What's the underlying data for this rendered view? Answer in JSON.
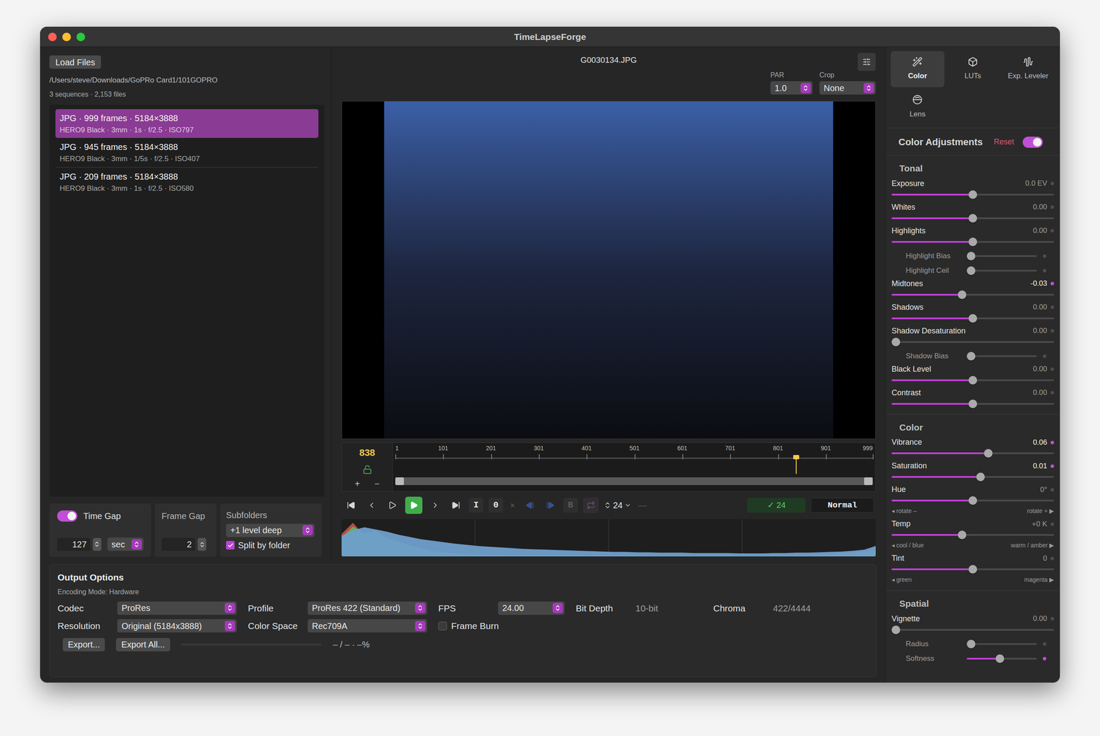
{
  "window": {
    "title": "TimeLapseForge"
  },
  "source": {
    "load_button": "Load Files",
    "path": "/Users/steve/Downloads/GoPRo Card1/101GOPRO",
    "summary": "3 sequences · 2,153 files"
  },
  "sequences": [
    {
      "title": "JPG · 999 frames · 5184×3888",
      "detail": "HERO9 Black · 3mm · 1s · f/2.5 · ISO797",
      "selected": true
    },
    {
      "title": "JPG · 945 frames · 5184×3888",
      "detail": "HERO9 Black · 3mm · 1/5s · f/2.5 · ISO407",
      "selected": false
    },
    {
      "title": "JPG · 209 frames · 5184×3888",
      "detail": "HERO9 Black · 3mm · 1s · f/2.5 · ISO580",
      "selected": false
    }
  ],
  "time_gap": {
    "label": "Time Gap",
    "on": true,
    "value": "127",
    "unit": "sec"
  },
  "frame_gap": {
    "label": "Frame Gap",
    "value": "2"
  },
  "subfolders": {
    "label": "Subfolders",
    "value": "+1 level deep",
    "split_label": "Split by folder",
    "split_checked": true
  },
  "preview": {
    "filename": "G0030134.JPG",
    "par": {
      "label": "PAR",
      "value": "1.0"
    },
    "crop": {
      "label": "Crop",
      "value": "None"
    }
  },
  "timeline": {
    "current_frame": "838",
    "locked": false,
    "add": "+",
    "remove": "−",
    "ticks": [
      "1",
      "101",
      "201",
      "301",
      "401",
      "501",
      "601",
      "701",
      "801",
      "901",
      "999"
    ],
    "playhead": 0.839,
    "range_start": 0,
    "range_end": 1
  },
  "transport": [
    {
      "kind": "first",
      "disabled": false
    },
    {
      "kind": "prev",
      "disabled": false
    },
    {
      "kind": "play",
      "disabled": false
    },
    {
      "kind": "play-green",
      "disabled": false
    },
    {
      "kind": "next",
      "disabled": false
    },
    {
      "kind": "last",
      "disabled": false
    },
    {
      "kind": "mark",
      "text": "I",
      "disabled": false
    },
    {
      "kind": "mark",
      "text": "0",
      "disabled": false
    },
    {
      "kind": "text",
      "text": "×",
      "disabled": true
    },
    {
      "kind": "step-back",
      "disabled": true
    },
    {
      "kind": "step-forward",
      "disabled": true
    },
    {
      "kind": "mark",
      "text": "B",
      "disabled": true
    },
    {
      "kind": "loop",
      "disabled": true
    },
    {
      "kind": "speed",
      "text": "24",
      "disabled": false
    },
    {
      "kind": "text",
      "text": "—",
      "disabled": true
    },
    {
      "kind": "status",
      "text": "✓ 24",
      "disabled": false
    },
    {
      "kind": "mode",
      "text": "Normal",
      "disabled": false
    }
  ],
  "histogram": {
    "series": [
      {
        "name": "red",
        "color": "#c0504a",
        "values": [
          60,
          90,
          55,
          65,
          45,
          35,
          25,
          18,
          12,
          8,
          6,
          5,
          4,
          3,
          3,
          3,
          2,
          2,
          2,
          2,
          2,
          2,
          2,
          2,
          2,
          2,
          2,
          2,
          2,
          2,
          2,
          2,
          2,
          2,
          2,
          2,
          2,
          2,
          3,
          3,
          3,
          4,
          5,
          6,
          8,
          10,
          14,
          20
        ]
      },
      {
        "name": "green",
        "color": "#5fb35a",
        "values": [
          50,
          80,
          62,
          70,
          48,
          40,
          30,
          22,
          15,
          10,
          8,
          6,
          5,
          4,
          4,
          3,
          3,
          3,
          3,
          3,
          3,
          3,
          2,
          2,
          2,
          2,
          2,
          2,
          2,
          2,
          2,
          2,
          2,
          2,
          2,
          2,
          2,
          2,
          2,
          3,
          3,
          3,
          4,
          4,
          5,
          6,
          8,
          15
        ]
      },
      {
        "name": "blue",
        "color": "#6f9fcc",
        "values": [
          55,
          70,
          78,
          72,
          66,
          58,
          52,
          46,
          42,
          38,
          34,
          31,
          28,
          26,
          24,
          22,
          20,
          19,
          18,
          17,
          16,
          15,
          14,
          13,
          12,
          12,
          11,
          11,
          10,
          10,
          10,
          9,
          9,
          9,
          9,
          8,
          8,
          8,
          9,
          9,
          10,
          10,
          11,
          12,
          13,
          15,
          18,
          28
        ]
      }
    ]
  },
  "output": {
    "title": "Output Options",
    "encoding": "Encoding Mode: Hardware",
    "rows": [
      [
        {
          "kind": "select",
          "label": "Codec",
          "value": "ProRes"
        },
        {
          "kind": "select",
          "label": "Profile",
          "value": "ProRes 422 (Standard)"
        },
        {
          "kind": "stepper",
          "label": "FPS",
          "value": "24.00"
        },
        {
          "kind": "static",
          "label": "Bit Depth",
          "value": "10-bit"
        },
        {
          "kind": "static",
          "label": "Chroma",
          "value": "422/4444"
        }
      ],
      [
        {
          "kind": "select",
          "label": "Resolution",
          "value": "Original (5184x3888)"
        },
        {
          "kind": "select",
          "label": "Color Space",
          "value": "Rec709A"
        },
        {
          "kind": "checkbox",
          "label": "Frame Burn",
          "checked": false
        }
      ]
    ],
    "buttons": [
      "Export...",
      "Export All..."
    ],
    "progress": {
      "level": 0,
      "text": "– / – · –%"
    }
  },
  "tabs": [
    {
      "label": "Color",
      "selected": true
    },
    {
      "label": "LUTs",
      "selected": false
    },
    {
      "label": "Exp. Leveler",
      "selected": false
    },
    {
      "label": "Lens",
      "selected": false
    }
  ],
  "adjustments": {
    "title": "Color Adjustments",
    "reset": "Reset",
    "on": true,
    "sections": [
      {
        "title": "Tonal",
        "rows": [
          {
            "kind": "main",
            "label": "Exposure",
            "value": "0.0 EV",
            "level": 0.5,
            "modified": false
          },
          {
            "kind": "main",
            "label": "Whites",
            "value": "0.00",
            "level": 0.5,
            "modified": false
          },
          {
            "kind": "main",
            "label": "Highlights",
            "value": "0.00",
            "level": 0.5,
            "modified": false
          },
          {
            "kind": "sub",
            "label": "Highlight Bias",
            "level": 0,
            "modified": false
          },
          {
            "kind": "sub",
            "label": "Highlight Ceil",
            "level": 0,
            "modified": false
          },
          {
            "kind": "main",
            "label": "Midtones",
            "value": "-0.03",
            "level": 0.43,
            "modified": true
          },
          {
            "kind": "main",
            "label": "Shadows",
            "value": "0.00",
            "level": 0.5,
            "modified": false
          },
          {
            "kind": "main",
            "label": "Shadow Desaturation",
            "value": "0.00",
            "level": 0,
            "modified": false
          },
          {
            "kind": "sub",
            "label": "Shadow Bias",
            "level": 0,
            "modified": false
          },
          {
            "kind": "main",
            "label": "Black Level",
            "value": "0.00",
            "level": 0.5,
            "modified": false
          },
          {
            "kind": "main",
            "label": "Contrast",
            "value": "0.00",
            "level": 0.5,
            "modified": false
          }
        ]
      },
      {
        "title": "Color",
        "rows": [
          {
            "kind": "main",
            "label": "Vibrance",
            "value": "0.06",
            "level": 0.6,
            "modified": true
          },
          {
            "kind": "main",
            "label": "Saturation",
            "value": "0.01",
            "level": 0.55,
            "modified": true
          },
          {
            "kind": "main",
            "label": "Hue",
            "value": "0°",
            "level": 0.5,
            "modified": false,
            "hint": {
              "left": "◂ rotate –",
              "right": "rotate + ▶"
            }
          },
          {
            "kind": "main",
            "label": "Temp",
            "value": "+0 K",
            "level": 0.43,
            "modified": false,
            "hint": {
              "left": "◂ cool / blue",
              "right": "warm / amber ▶"
            }
          },
          {
            "kind": "main",
            "label": "Tint",
            "value": "0",
            "level": 0.5,
            "modified": false,
            "hint": {
              "left": "◂ green",
              "right": "magenta ▶"
            }
          }
        ]
      },
      {
        "title": "Spatial",
        "rows": [
          {
            "kind": "main",
            "label": "Vignette",
            "value": "0.00",
            "level": 0,
            "modified": false
          },
          {
            "kind": "sub",
            "label": "Radius",
            "level": 0,
            "modified": false
          },
          {
            "kind": "sub",
            "label": "Softness",
            "level": 0.47,
            "modified": true
          }
        ]
      }
    ]
  }
}
